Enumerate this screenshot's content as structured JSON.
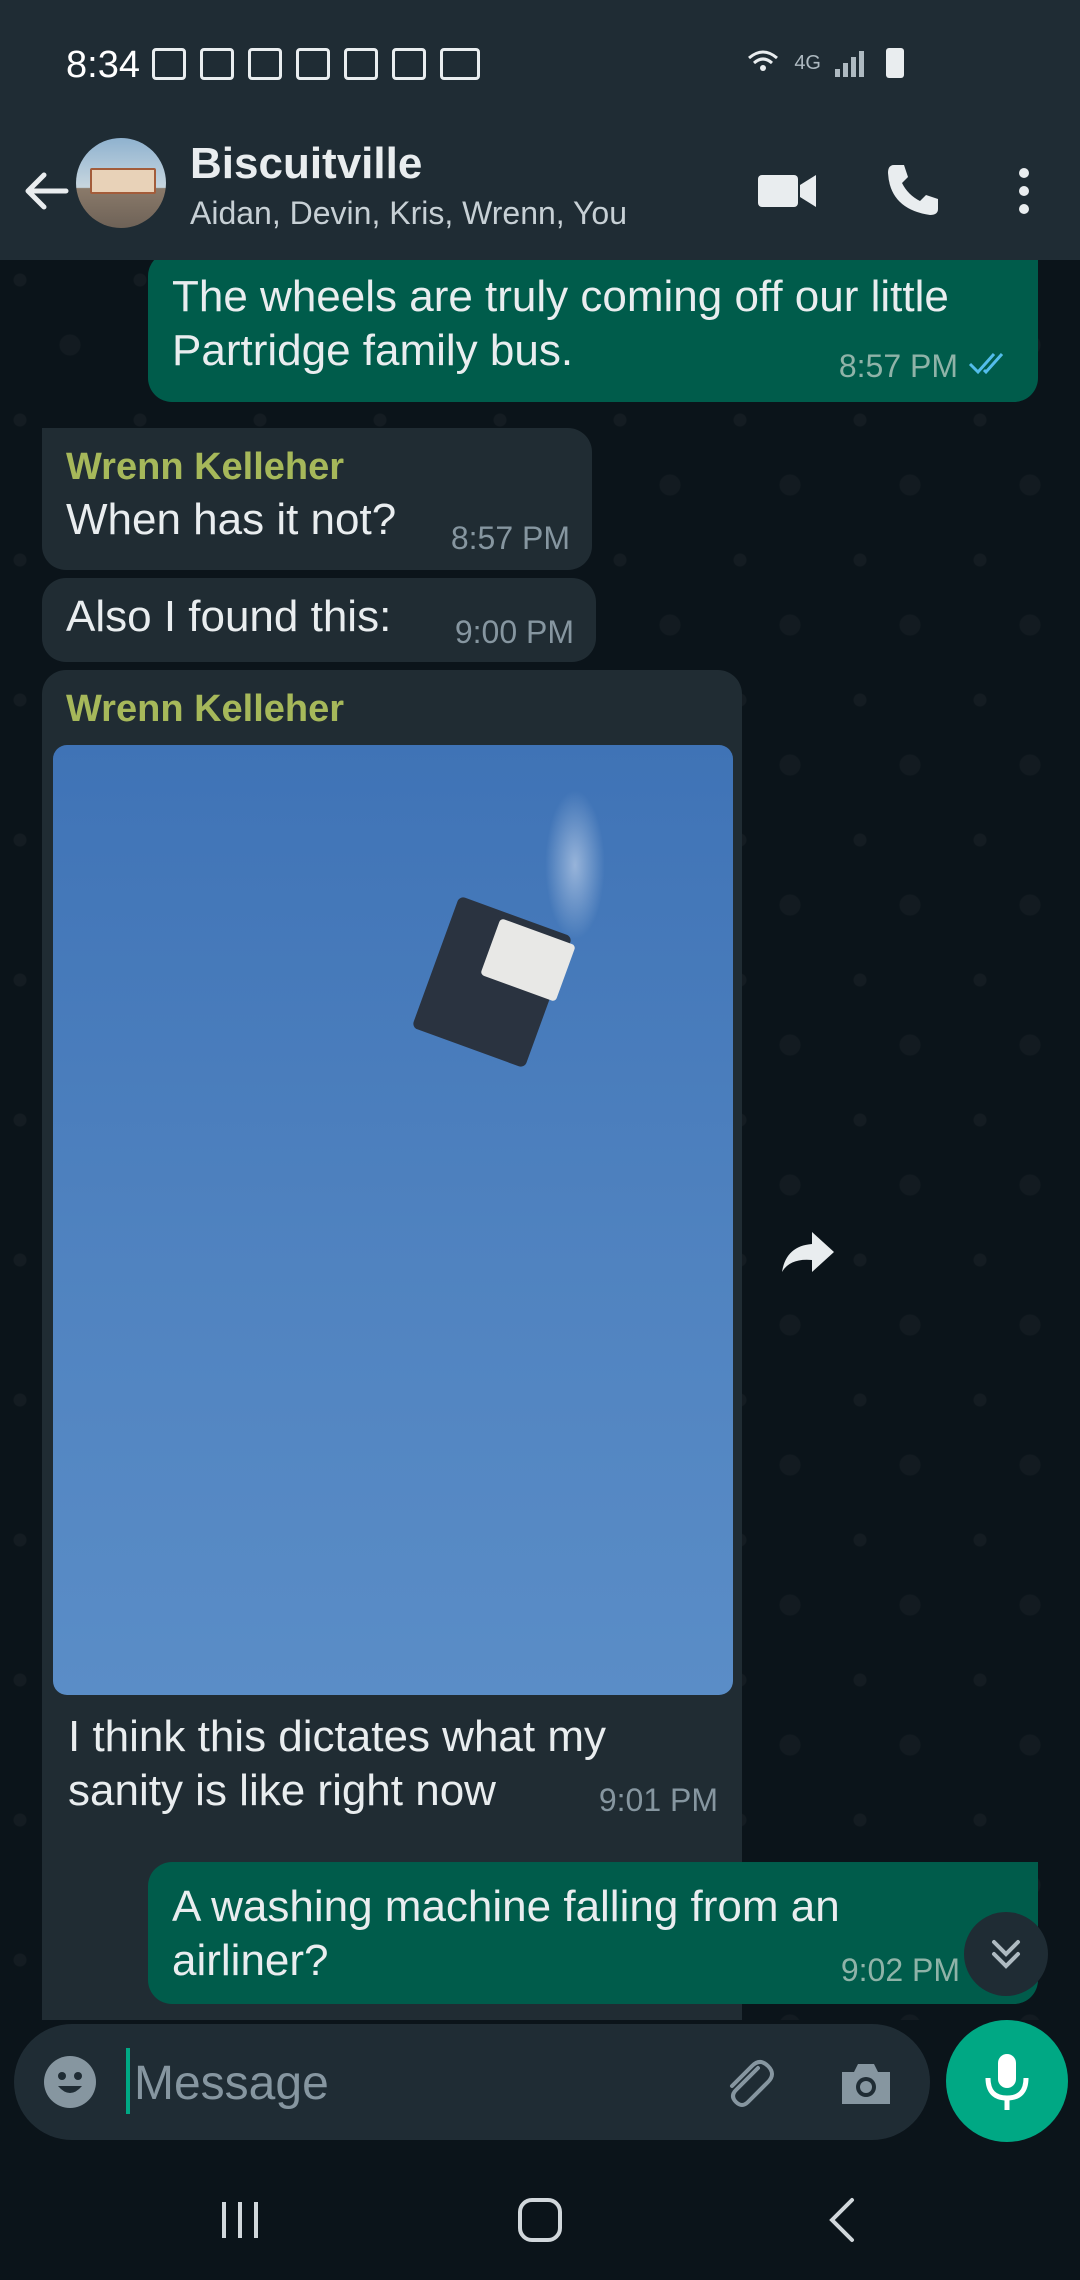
{
  "status_bar": {
    "time": "8:34",
    "network": "4G",
    "notification_icons": [
      "cast-icon",
      "linkedin-icon",
      "app-icon",
      "app-icon",
      "app-icon",
      "gallery-icon",
      "laptop-icon"
    ]
  },
  "header": {
    "title": "Biscuitville",
    "subtitle": "Aidan, Devin, Kris, Wrenn, You"
  },
  "messages": [
    {
      "direction": "out",
      "text": "The wheels are truly coming off our little Partridge family bus.",
      "time": "8:57 PM",
      "status": "read"
    },
    {
      "direction": "in",
      "sender": "Wrenn Kelleher",
      "text": "When has it not?",
      "time": "8:57 PM"
    },
    {
      "direction": "in",
      "text": "Also I found this:",
      "time": "9:00 PM"
    },
    {
      "direction": "in",
      "sender": "Wrenn Kelleher",
      "type": "image",
      "caption": "I think this dictates what my sanity is like right now",
      "time": "9:01 PM"
    },
    {
      "direction": "out",
      "text": "A washing machine falling from an airliner?",
      "time": "9:02 PM"
    }
  ],
  "composer": {
    "placeholder": "Message"
  },
  "colors": {
    "outgoing_bubble": "#005c4b",
    "incoming_bubble": "#202c33",
    "accent": "#00a884",
    "sender_name": "#a6b85a"
  }
}
